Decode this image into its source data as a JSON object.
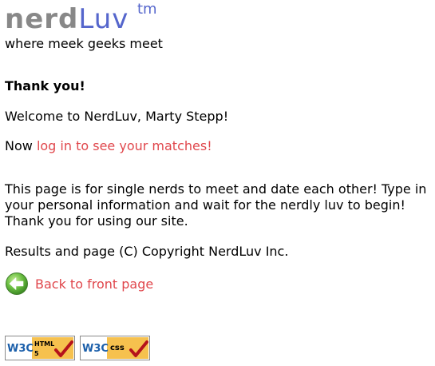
{
  "logo": {
    "nerd": "nerd",
    "luv": "Luv",
    "tm": "tm"
  },
  "tagline": "where meek geeks meet",
  "heading": "Thank you!",
  "welcome": "Welcome to NerdLuv, Marty Stepp!",
  "login": {
    "prefix": "Now",
    "link": "log in to see your matches!"
  },
  "about": "This page is for single nerds to meet and date each other! Type in your personal information and wait for the nerdly luv to begin! Thank you for using our site.",
  "copyright": "Results and page (C) Copyright NerdLuv Inc.",
  "back": {
    "label": "Back to front page",
    "icon": "back-arrow-icon"
  },
  "badges": {
    "html": {
      "w3c": "W3C",
      "label": "HTML",
      "version": "5"
    },
    "css": {
      "w3c": "W3C",
      "label": "css"
    }
  },
  "colors": {
    "link": "#e0474c",
    "logo_gray": "#888888",
    "logo_blue": "#5566cc",
    "badge_gold": "#f6c14e",
    "check_red": "#b5121b",
    "w3c_blue": "#1b5faa"
  }
}
